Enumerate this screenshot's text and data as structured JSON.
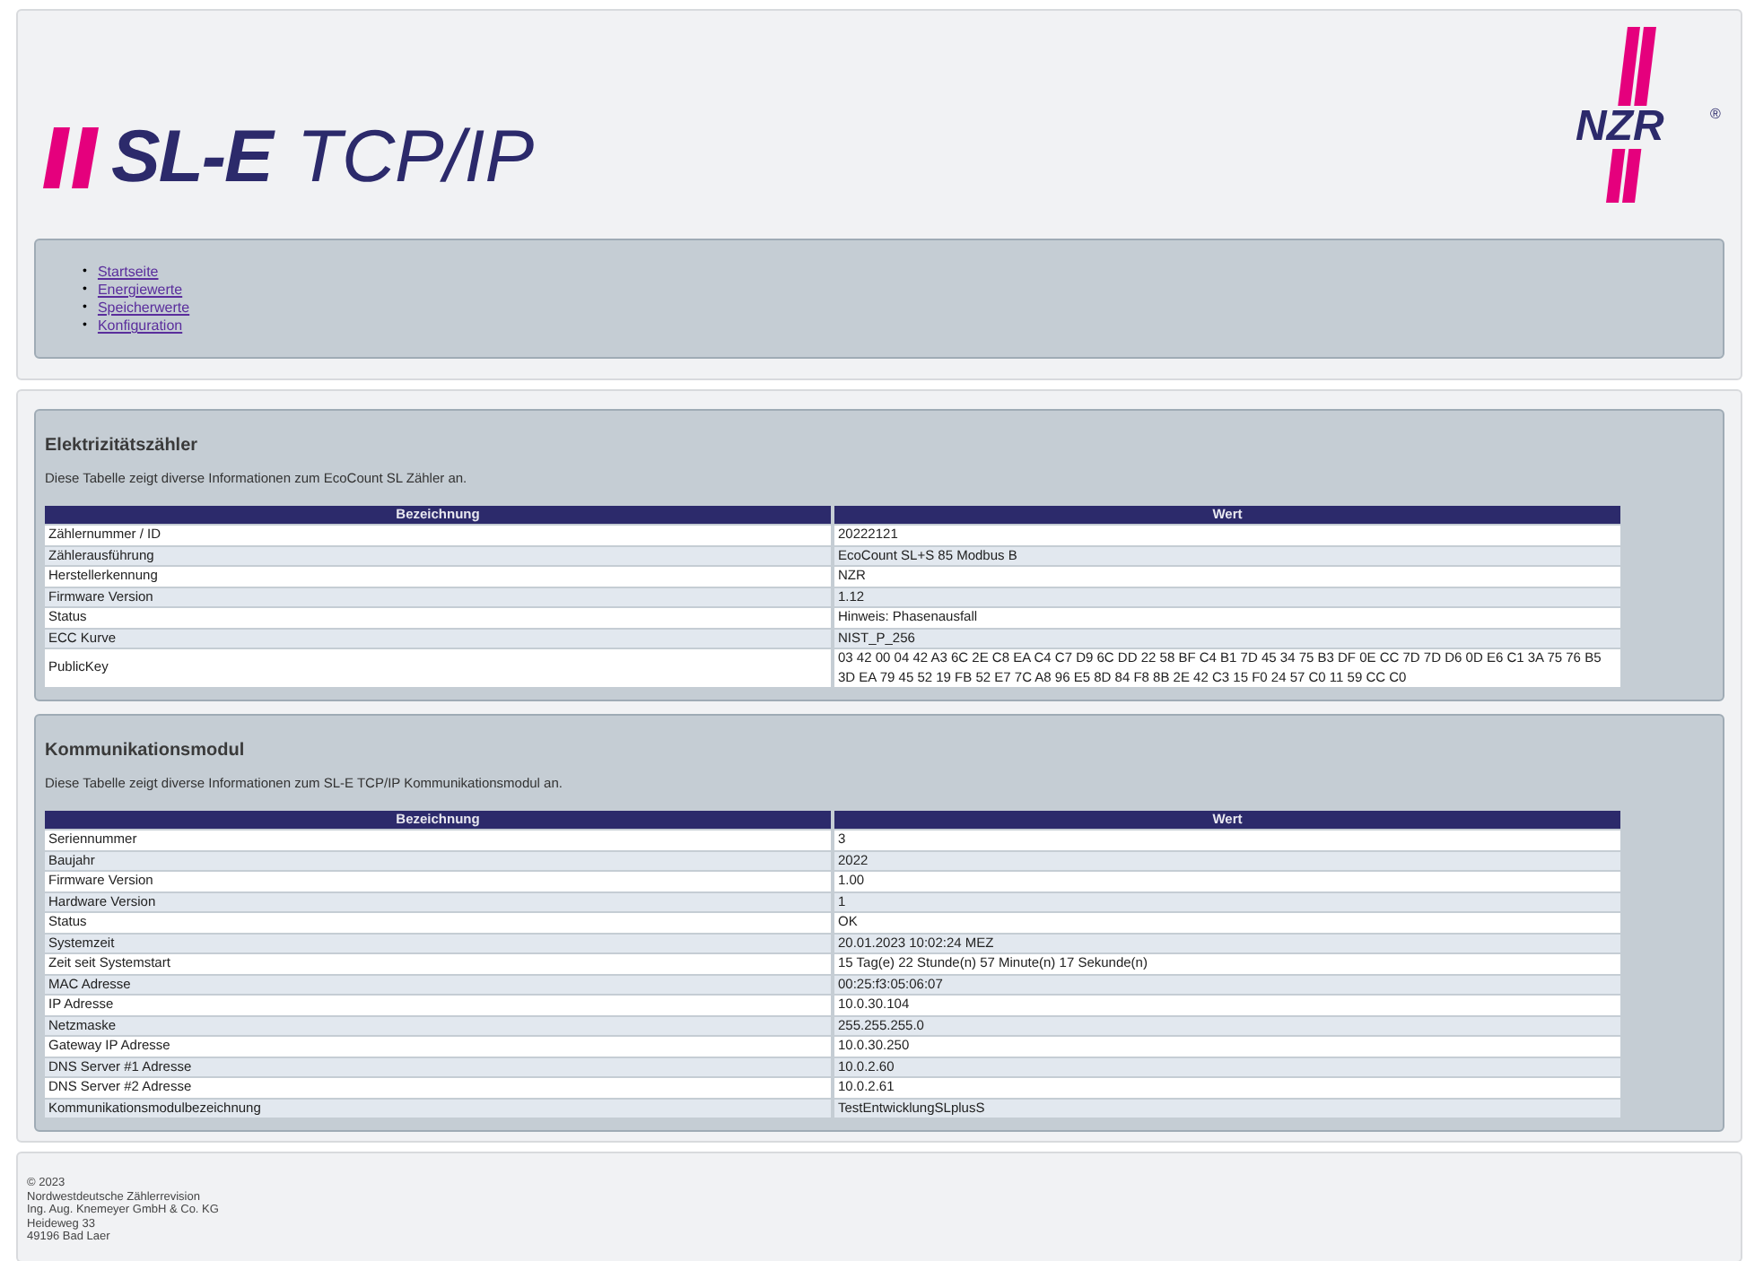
{
  "header": {
    "logo": {
      "bold": "SL-E",
      "light": "TCP/IP"
    },
    "brand": {
      "name": "NZR",
      "mark": "®"
    }
  },
  "nav": [
    {
      "bullet": "•",
      "label": "Startseite"
    },
    {
      "bullet": "•",
      "label": "Energiewerte"
    },
    {
      "bullet": "•",
      "label": "Speicherwerte"
    },
    {
      "bullet": "•",
      "label": "Konfiguration"
    }
  ],
  "sections": [
    {
      "title": "Elektrizitätszähler",
      "description": "Diese Tabelle zeigt diverse Informationen zum EcoCount SL Zähler an.",
      "columns": [
        "Bezeichnung",
        "Wert"
      ],
      "rows": [
        [
          "Zählernummer / ID",
          "20222121"
        ],
        [
          "Zählerausführung",
          "EcoCount SL+S 85 Modbus B"
        ],
        [
          "Herstellerkennung",
          "NZR"
        ],
        [
          "Firmware Version",
          "1.12"
        ],
        [
          "Status",
          "Hinweis: Phasenausfall"
        ],
        [
          "ECC Kurve",
          "NIST_P_256"
        ],
        [
          "PublicKey",
          "03 42 00 04 42 A3 6C 2E C8 EA C4 C7 D9 6C DD 22 58 BF C4 B1 7D 45 34 75 B3 DF 0E CC 7D 7D D6 0D E6 C1 3A 75 76 B5 3D EA 79 45 52 19 FB 52 E7 7C A8 96 E5 8D 84 F8 8B 2E 42 C3 15 F0 24 57 C0 11 59 CC C0"
        ]
      ]
    },
    {
      "title": "Kommunikationsmodul",
      "description": "Diese Tabelle zeigt diverse Informationen zum SL-E TCP/IP Kommunikationsmodul an.",
      "columns": [
        "Bezeichnung",
        "Wert"
      ],
      "rows": [
        [
          "Seriennummer",
          "3"
        ],
        [
          "Baujahr",
          "2022"
        ],
        [
          "Firmware Version",
          "1.00"
        ],
        [
          "Hardware Version",
          "1"
        ],
        [
          "Status",
          "OK"
        ],
        [
          "Systemzeit",
          "20.01.2023 10:02:24 MEZ"
        ],
        [
          "Zeit seit Systemstart",
          "15 Tag(e) 22 Stunde(n) 57 Minute(n) 17 Sekunde(n)"
        ],
        [
          "MAC Adresse",
          "00:25:f3:05:06:07"
        ],
        [
          "IP Adresse",
          "10.0.30.104"
        ],
        [
          "Netzmaske",
          "255.255.255.0"
        ],
        [
          "Gateway IP Adresse",
          "10.0.30.250"
        ],
        [
          "DNS Server #1 Adresse",
          "10.0.2.60"
        ],
        [
          "DNS Server #2 Adresse",
          "10.0.2.61"
        ],
        [
          "Kommunikationsmodulbezeichnung",
          "TestEntwicklungSLplusS"
        ]
      ]
    }
  ],
  "footer": [
    "© 2023",
    "Nordwestdeutsche Zählerrevision",
    "Ing. Aug. Knemeyer GmbH & Co. KG",
    "Heideweg 33",
    "49196 Bad Laer"
  ]
}
